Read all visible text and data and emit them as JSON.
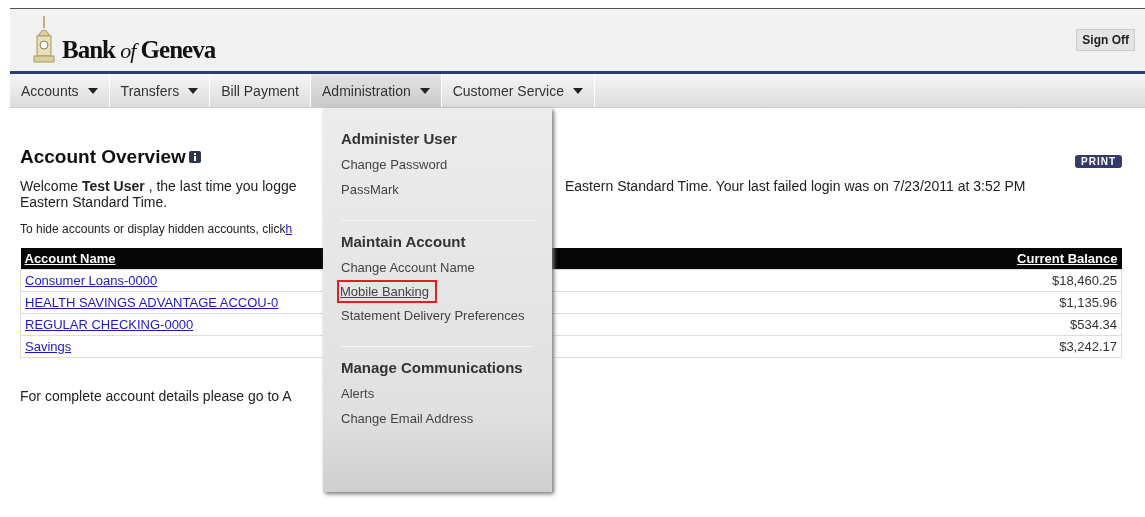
{
  "header": {
    "logo": "Bank of Geneva",
    "sign_off": "Sign Off"
  },
  "nav": [
    {
      "label": "Accounts",
      "dropdown": true,
      "selected": false
    },
    {
      "label": "Transfers",
      "dropdown": true,
      "selected": false
    },
    {
      "label": "Bill Payment",
      "dropdown": false,
      "selected": false
    },
    {
      "label": "Administration",
      "dropdown": true,
      "selected": true
    },
    {
      "label": "Customer Service",
      "dropdown": true,
      "selected": false
    }
  ],
  "page": {
    "title": "Account Overview",
    "print": "PRINT",
    "welcome_left": "Welcome **Test User** , the last time you logge",
    "welcome_right": "Eastern Standard Time. Your last failed login was on 7/23/2011 at 3:52 PM",
    "welcome_line2": "Eastern Standard Time.",
    "hide_text": "To hide accounts or display hidden accounts, click",
    "hide_link": "h",
    "footer_text": "For complete account details please go to A"
  },
  "table": {
    "columns": [
      "Account Name",
      "Current Balance"
    ],
    "rows": [
      {
        "name": "Consumer Loans-0000",
        "balance": "$18,460.25"
      },
      {
        "name": "HEALTH SAVINGS ADVANTAGE ACCOU-0",
        "balance": "$1,135.96"
      },
      {
        "name": "REGULAR CHECKING-0000",
        "balance": "$534.34"
      },
      {
        "name": "Savings",
        "balance": "$3,242.17"
      }
    ]
  },
  "menu": [
    {
      "heading": "Administer User",
      "items": [
        {
          "label": "Change Password",
          "selected": false
        },
        {
          "label": "PassMark",
          "selected": false
        }
      ]
    },
    {
      "heading": "Maintain Account",
      "items": [
        {
          "label": "Change Account Name",
          "selected": false
        },
        {
          "label": "Mobile Banking",
          "selected": true
        },
        {
          "label": "Statement Delivery Preferences",
          "selected": false
        }
      ]
    },
    {
      "heading": "Manage Communications",
      "items": [
        {
          "label": "Alerts",
          "selected": false
        },
        {
          "label": "Change Email Address",
          "selected": false
        }
      ]
    }
  ]
}
